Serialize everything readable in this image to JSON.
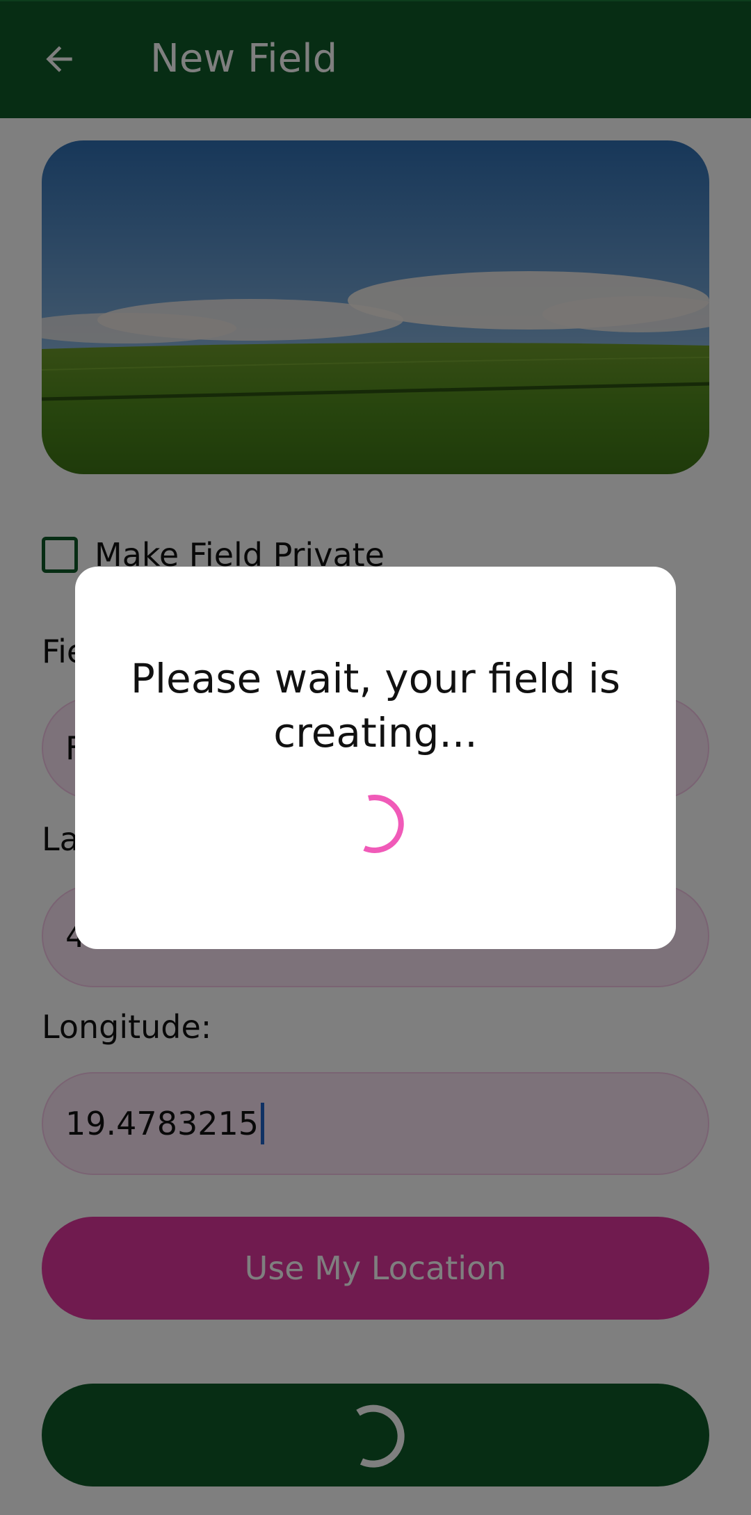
{
  "appbar": {
    "title": "New Field",
    "back_icon": "arrow-left-icon"
  },
  "hero": {
    "image": "field-landscape-photo"
  },
  "form": {
    "private_checkbox": {
      "label": "Make Field Private",
      "checked": false
    },
    "name_label": "Fie",
    "name_value": "F",
    "latitude_label": "La",
    "latitude_value": "4",
    "longitude_label": "Longitude:",
    "longitude_value": "19.4783215",
    "use_location_label": "Use My Location",
    "submit_state": "loading"
  },
  "dialog": {
    "message": "Please wait, your field is creating..."
  },
  "colors": {
    "primary_green": "#0f5a28",
    "accent_pink": "#e0379e",
    "field_bg": "#fbe4f4",
    "spinner_pink": "#f05ab8"
  }
}
